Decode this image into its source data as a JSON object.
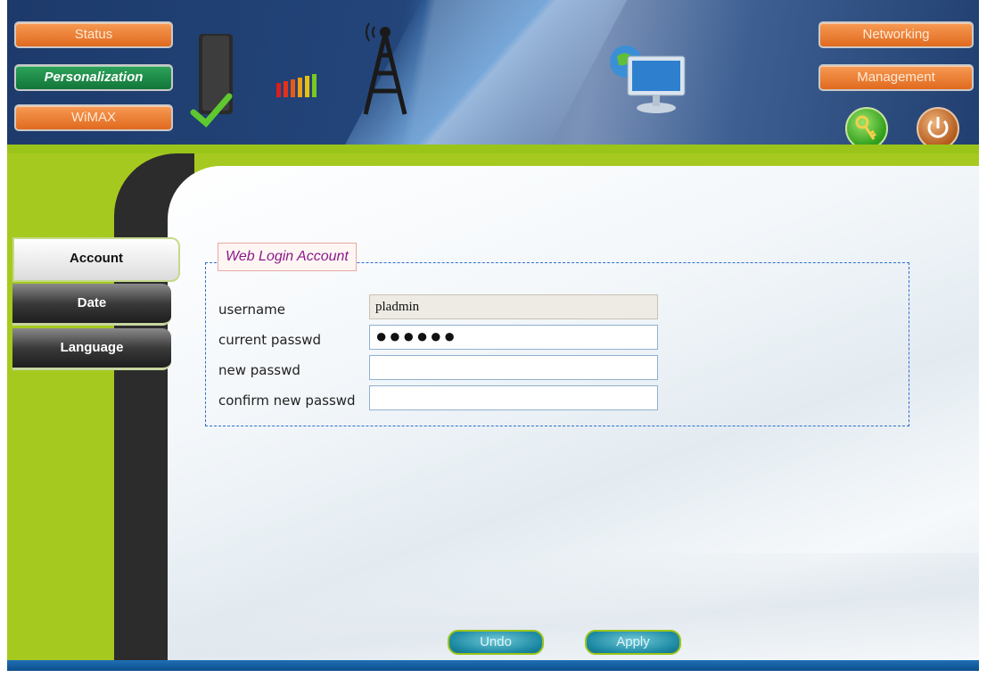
{
  "nav": {
    "left": [
      {
        "label": "Status",
        "active": false
      },
      {
        "label": "Personalization",
        "active": true
      },
      {
        "label": "WiMAX",
        "active": false
      }
    ],
    "right": [
      {
        "label": "Networking"
      },
      {
        "label": "Management"
      }
    ],
    "icons": [
      "key-icon",
      "power-icon"
    ]
  },
  "side_tabs": [
    {
      "label": "Account",
      "active": true
    },
    {
      "label": "Date",
      "active": false
    },
    {
      "label": "Language",
      "active": false
    }
  ],
  "form": {
    "legend": "Web Login Account",
    "fields": [
      {
        "label": "username",
        "value": "pladmin",
        "readonly": true
      },
      {
        "label": "current passwd",
        "value": "●●●●●●",
        "type": "password"
      },
      {
        "label": "new passwd",
        "value": "",
        "type": "password"
      },
      {
        "label": "confirm new passwd",
        "value": "",
        "type": "password"
      }
    ]
  },
  "buttons": {
    "undo": "Undo",
    "apply": "Apply"
  },
  "colors": {
    "accent_green": "#9ac41a",
    "nav_orange": "#e8782a",
    "nav_active": "#1f8a46",
    "header_blue": "#1d3a6b",
    "footer_blue": "#1f6fb4"
  }
}
